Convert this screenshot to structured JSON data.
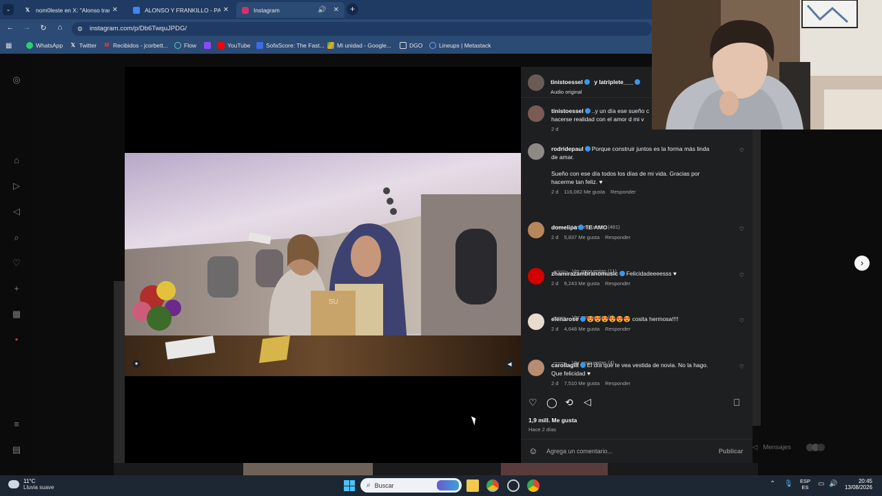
{
  "browser": {
    "tabs": [
      {
        "title": "nom0leste en X: \"Alonso trandi",
        "icon": "x-icon",
        "active": false
      },
      {
        "title": "ALONSO Y FRANKILLO - PAN C",
        "icon": "document-icon",
        "active": false
      },
      {
        "title": "Instagram",
        "icon": "instagram-icon",
        "active": true
      }
    ],
    "url": "instagram.com/p/Db6TwquJPDG/",
    "bookmarks": [
      {
        "label": "WhatsApp",
        "icon": "whatsapp-icon"
      },
      {
        "label": "Twitter",
        "icon": "x-icon"
      },
      {
        "label": "Recibidos - jcorbett...",
        "icon": "gmail-icon"
      },
      {
        "label": "Flow",
        "icon": "flow-icon"
      },
      {
        "label": "",
        "icon": "twitch-icon"
      },
      {
        "label": "YouTube",
        "icon": "youtube-icon"
      },
      {
        "label": "SofaScore: The Fast...",
        "icon": "sofascore-icon"
      },
      {
        "label": "Mi unidad - Google...",
        "icon": "drive-icon"
      },
      {
        "label": "DGO",
        "icon": "folder-icon"
      },
      {
        "label": "Lineups | Metastack",
        "icon": "metastack-icon"
      }
    ]
  },
  "post": {
    "header": {
      "user": "tinistoessel",
      "coauthor": "y latriplete___",
      "audio": "Audio original"
    },
    "comments": [
      {
        "user": "tinistoessel",
        "lines": [
          "..y un día ese sueño c",
          "hacerse realidad con el amor d mi v"
        ],
        "time": "2 d",
        "likes": "",
        "reply": "",
        "replies": "",
        "avatar_color": "#7a5c55"
      },
      {
        "user": "rodridepaul",
        "lines": [
          "Porque construir juntos es la forma más linda",
          "de amar.",
          "",
          "Sueño con ese día todos los días de mi vida. Gracias por",
          "hacerme tan feliz. ♥"
        ],
        "time": "2 d",
        "likes": "116,082 Me gusta",
        "reply": "Responder",
        "replies": "Ver respuestas (481)",
        "avatar_color": "#8d8a85"
      },
      {
        "user": "domelipa",
        "lines": [
          "TE AMO"
        ],
        "time": "2 d",
        "likes": "5,837 Me gusta",
        "reply": "Responder",
        "replies": "Ver respuestas (11)",
        "avatar_color": "#b8865b"
      },
      {
        "user": "zhamirazambranomusic",
        "lines": [
          "Felicidadeeeesss ♥"
        ],
        "time": "2 d",
        "likes": "9,243 Me gusta",
        "reply": "Responder",
        "replies": "Ver respuestas (6)",
        "avatar_color": "#d40000"
      },
      {
        "user": "elenarose",
        "lines": [
          "😍😍😍😍😍😍 cosita hermosa!!!!"
        ],
        "time": "2 d",
        "likes": "4,648 Me gusta",
        "reply": "Responder",
        "replies": "Ver respuestas (4)",
        "avatar_color": "#e8dccf"
      },
      {
        "user": "carollagill",
        "lines": [
          "El día que te vea vestida de novia. No la hago.",
          "Que felicidad ♥"
        ],
        "time": "2 d",
        "likes": "7,510 Me gusta",
        "reply": "Responder",
        "replies": "",
        "avatar_color": "#b88c70"
      }
    ],
    "likes": "1,9 mill. Me gusta",
    "posted": "Hace 2 días",
    "comment_placeholder": "Agrega un comentario...",
    "publish": "Publicar"
  },
  "background": {
    "messages": "Mensajes"
  },
  "taskbar": {
    "weather_temp": "11°C",
    "weather_desc": "Lluvia suave",
    "search": "Buscar",
    "lang": "ESP",
    "lang_sub": "ES",
    "time": "20:45",
    "date": "13/08/2026"
  }
}
